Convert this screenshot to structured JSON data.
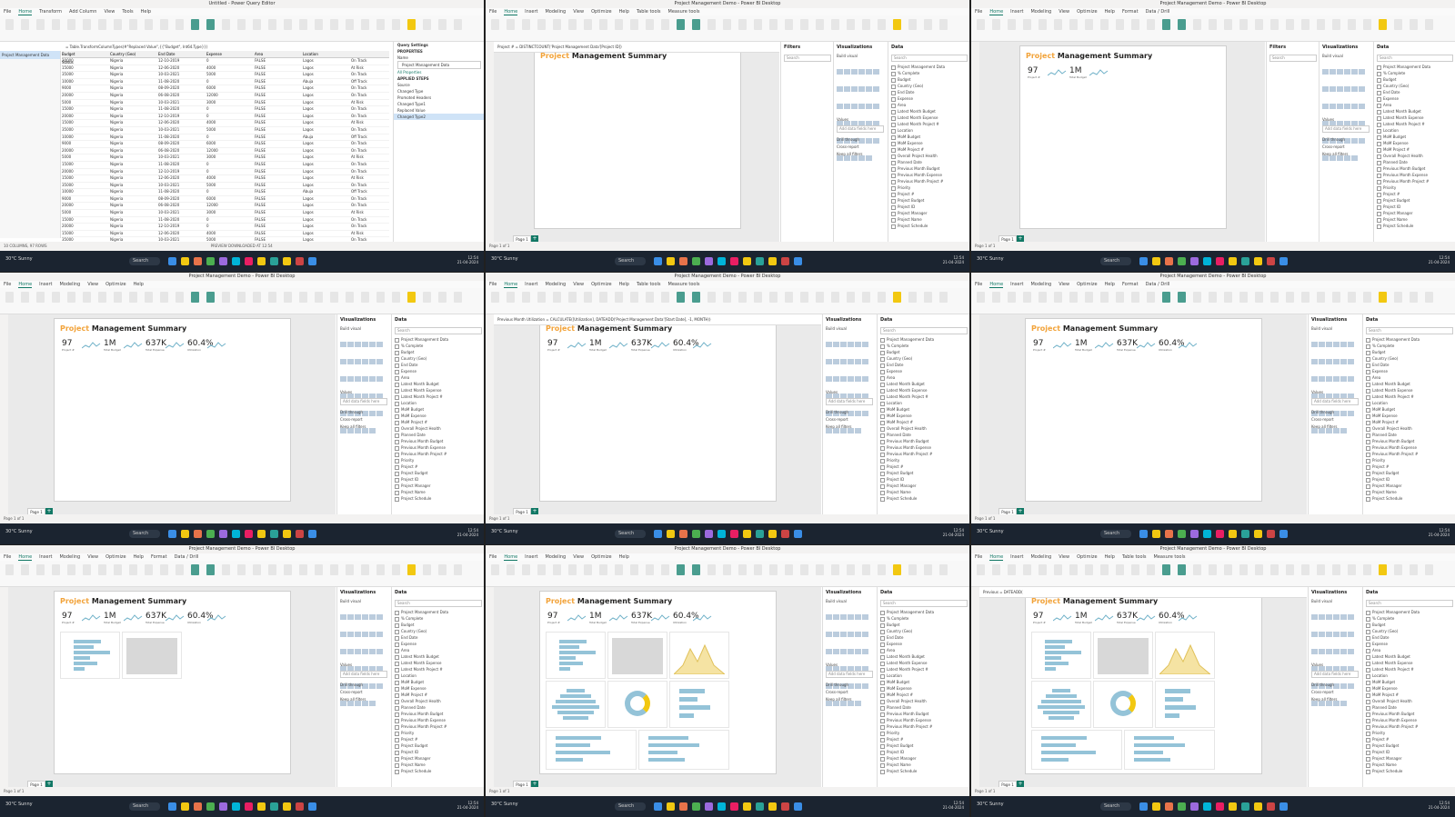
{
  "app_title": "Project Management Demo - Power BI Desktop",
  "pq_title": "Untitled - Power Query Editor",
  "menu": [
    "File",
    "Home",
    "Insert",
    "Modeling",
    "View",
    "Optimize",
    "Help"
  ],
  "menu_table_tools": [
    "File",
    "Home",
    "Insert",
    "Modeling",
    "View",
    "Optimize",
    "Help",
    "Table tools",
    "Measure tools"
  ],
  "menu_format": [
    "File",
    "Home",
    "Insert",
    "Modeling",
    "View",
    "Optimize",
    "Help",
    "Format",
    "Data / Drill"
  ],
  "pq_menu": [
    "File",
    "Home",
    "Transform",
    "Add Column",
    "View",
    "Tools",
    "Help"
  ],
  "report_title_word1": "Project",
  "report_title_word2": "Management Summary",
  "kpis": [
    {
      "value": "97",
      "label": "Project #"
    },
    {
      "value": "1M",
      "label": "Total Budget"
    },
    {
      "value": "637K",
      "label": "Total Expense"
    },
    {
      "value": "60.4%",
      "label": "Utilization"
    }
  ],
  "panes": {
    "filters": "Filters",
    "visualizations": "Visualizations",
    "data": "Data",
    "search": "Search",
    "build_visual": "Build visual",
    "values": "Values",
    "add_fields": "Add data fields here",
    "drill_through": "Drill through",
    "cross_report": "Cross-report",
    "keep_filters": "Keep all filters"
  },
  "data_fields": [
    "Project Management Data",
    "% Complete",
    "Budget",
    "Country (Geo)",
    "End Date",
    "Expense",
    "Area",
    "Latest Month Budget",
    "Latest Month Expense",
    "Latest Month Project #",
    "Location",
    "MoM Budget",
    "MoM Expense",
    "MoM Project #",
    "Overall Project Health",
    "Planned Date",
    "Previous Month Budget",
    "Previous Month Expense",
    "Previous Month Project #",
    "Priority",
    "Project #",
    "Project Budget",
    "Project ID",
    "Project Manager",
    "Project Name",
    "Project Schedule",
    "Project Type",
    "Start Date",
    "Status"
  ],
  "page_tab": "Page 1",
  "page_status": "Page 1 of 1",
  "formula_1": "Project # = DISTINCTCOUNT('Project Management Data'[Project ID])",
  "formula_2": "Previous Month Utilization = CALCULATE([Utilization], DATEADD('Project Management Data'[Start Date], -1, MONTH))",
  "formula_3": "Previous = DATEADD(",
  "pq_formula": "= Table.TransformColumnTypes(#\"Replaced Value\",{{\"Budget\", Int64.Type}})",
  "pq_query": "Project Management Data",
  "pq_headers": [
    "Budget",
    "Country (Geo)",
    "End Date",
    "Expense",
    "Area",
    "Location",
    "Status"
  ],
  "pq_rows": [
    [
      "20000",
      "Nigeria",
      "12-10-2019",
      "0",
      "FALSE",
      "Lagos",
      "On Track"
    ],
    [
      "15000",
      "Nigeria",
      "12-06-2020",
      "4000",
      "FALSE",
      "Lagos",
      "At Risk"
    ],
    [
      "35000",
      "Nigeria",
      "10-03-2021",
      "5000",
      "FALSE",
      "Lagos",
      "On Track"
    ],
    [
      "10000",
      "Nigeria",
      "11-08-2020",
      "0",
      "FALSE",
      "Abuja",
      "Off Track"
    ],
    [
      "9000",
      "Nigeria",
      "08-09-2020",
      "6000",
      "FALSE",
      "Lagos",
      "On Track"
    ],
    [
      "20000",
      "Nigeria",
      "06-08-2020",
      "12000",
      "FALSE",
      "Lagos",
      "On Track"
    ],
    [
      "5000",
      "Nigeria",
      "10-03-2021",
      "3000",
      "FALSE",
      "Lagos",
      "At Risk"
    ],
    [
      "15000",
      "Nigeria",
      "11-08-2020",
      "0",
      "FALSE",
      "Lagos",
      "On Track"
    ]
  ],
  "pq_properties": "PROPERTIES",
  "pq_name_label": "Name",
  "pq_all_properties": "All Properties",
  "pq_applied_steps": "APPLIED STEPS",
  "pq_steps": [
    "Source",
    "Changed Type",
    "Promoted Headers",
    "Changed Type1",
    "Replaced Value",
    "Changed Type2"
  ],
  "pq_status": "10 COLUMNS, 97 ROWS",
  "pq_status_right": "PREVIEW DOWNLOADED AT 12:54",
  "pq_query_settings": "Query Settings",
  "taskbar_weather": "30°C Sunny",
  "taskbar_search": "Search",
  "taskbar_time": "12:54",
  "taskbar_date": "21-04-2024",
  "colors": {
    "accent": "#117865",
    "title_orange": "#f2a33a",
    "bar": "#94c3d8",
    "taskbar": "#1b2430"
  }
}
